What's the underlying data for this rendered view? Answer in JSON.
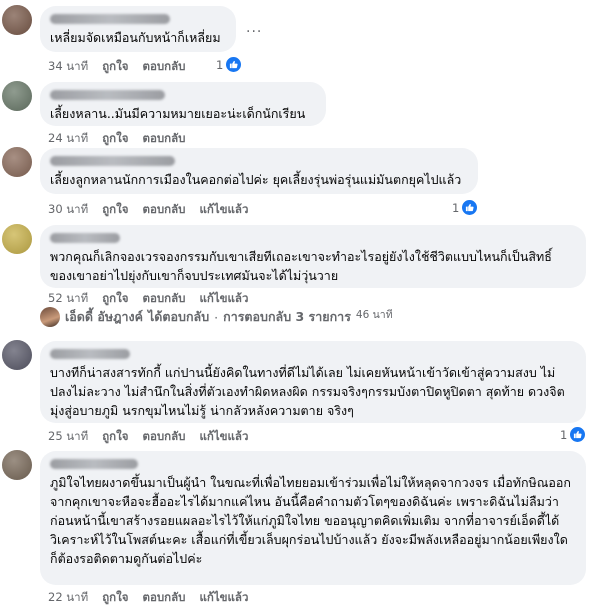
{
  "comments": [
    {
      "text": "เหลี่ยมจัดเหมือนกับหน้าก็เหลี่ยม",
      "time": "34 นาที",
      "like": "ถูกใจ",
      "reply": "ตอบกลับ",
      "edited": "",
      "reactions": "1",
      "avatar_color": "#7a5a4a"
    },
    {
      "text": "เลี้ยงหลาน..มันมีความหมายเยอะน่ะเด็กนักเรียน",
      "time": "24 นาที",
      "like": "ถูกใจ",
      "reply": "ตอบกลับ",
      "edited": "",
      "reactions": "",
      "avatar_color": "#6a7a6a"
    },
    {
      "text": "เลี้ยงลูกหลานนักการเมืองในคอกต่อไปค่ะ ยุคเลี้ยงรุ่นพ่อรุ่นแม่มันตกยุคไปแล้ว",
      "time": "30 นาที",
      "like": "ถูกใจ",
      "reply": "ตอบกลับ",
      "edited": "แก้ไขแล้ว",
      "reactions": "1",
      "avatar_color": "#8a6a5a"
    },
    {
      "text": "พวกคุณก็เลิกจองเวรจองกรรมกับเขาเสียทีเถอะเขาจะทำอะไรอยู่ยังไงใช้ชีวิตแบบไหนก็เป็นสิทธิ์ของเขาอย่าไปยุ่งกับเขาก็จบประเทศมันจะได้ไม่วุ่นวาย",
      "time": "52 นาที",
      "like": "ถูกใจ",
      "reply": "ตอบกลับ",
      "edited": "แก้ไขแล้ว",
      "reactions": "",
      "avatar_color": "#c9b24a"
    },
    {
      "text": "บางทีก็น่าสงสารทักกี้ แก่ปานนี้ยังคิดในทางที่ดีไม่ได้เลย ไม่เคยหันหน้าเข้าวัดเข้าสู่ความสงบ ไม่ปลงไม่ละวาง ไม่สำนึกในสิ่งที่ตัวเองทำผิดหลงผิด กรรมจริงๆกรรมบังตาปิดหูปิดตา สุดท้าย ดวงจิตมุ่งสู่อบายภูมิ นรกขุมไหนไม่รู้ น่ากลัวหลังความตาย จริงๆ",
      "time": "25 นาที",
      "like": "ถูกใจ",
      "reply": "ตอบกลับ",
      "edited": "แก้ไขแล้ว",
      "reactions": "1",
      "avatar_color": "#5a5a6a"
    },
    {
      "text": "ภูมิใจไทยผงาดขึ้นมาเป็นผู้นำ ในขณะที่เพื่อไทยยอมเข้าร่วมเพื่อไม่ให้หลุดจากวงจร เมื่อทักษิณออกจากคุกเขาจะหือจะฮื้ออะไรได้มากแค่ไหน อันนี้คือคำถามตัวโตๆของดิฉันค่ะ เพราะดิฉันไม่ลืมว่า ก่อนหน้านี้เขาสร้างรอยแผลอะไรไว้ให้แก่ภูมิใจไทย ขออนุญาตคิดเพิ่มเติม จากที่อาจารย์เอ็ดดี้ได้วิเคราะห์ไว้ในโพสต์นะคะ เสื้อแก่ที่เขี้ยวเล็บผุกร่อนไปบ้างแล้ว ยังจะมีพลังเหลืออยู่มากน้อยเพียงใด ก็ต้องรอติดตามดูกันต่อไปค่ะ",
      "time": "22 นาที",
      "like": "ถูกใจ",
      "reply": "ตอบกลับ",
      "edited": "แก้ไขแล้ว",
      "reactions": "",
      "avatar_color": "#7a6a5a"
    }
  ],
  "reply_thread": {
    "name": "เอ็ดดี้ อัษฎางค์",
    "action": "ได้ตอบกลับ",
    "separator": "·",
    "count": "การตอบกลับ 3 รายการ",
    "time": "46 นาที"
  },
  "more_label": "...",
  "colors": {
    "bubble": "#f0f2f5",
    "like_blue": "#1877f2",
    "meta": "#65676b"
  }
}
